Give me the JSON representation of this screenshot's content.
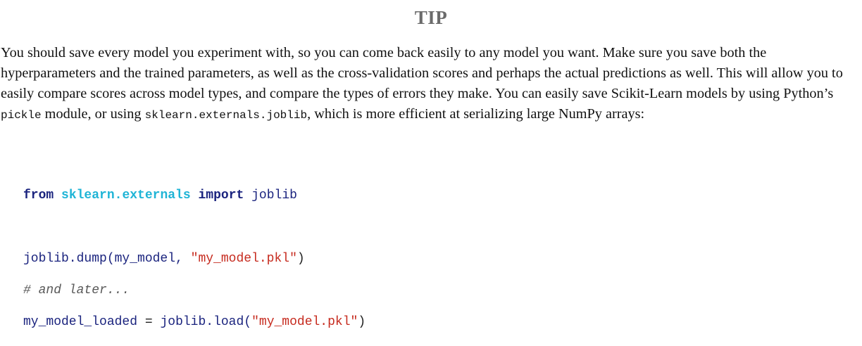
{
  "title": "TIP",
  "paragraph": {
    "text_1": "You should save every model you experiment with, so you can come back easily to any model you want. Make sure you save both the hyperparameters and the trained parameters, as well as the cross-validation scores and perhaps the actual predictions as well. This will allow you to easily compare scores across model types, and compare the types of errors they make. You can easily save Scikit-Learn models by using Python’s ",
    "code_1": "pickle",
    "text_2": " module, or using ",
    "code_2": "sklearn.externals.joblib",
    "text_3": ", which is more efficient at serializing large NumPy arrays:"
  },
  "code": {
    "line1": {
      "kw_from": "from",
      "module": "sklearn.externals",
      "kw_import": "import",
      "name": "joblib"
    },
    "line2": {
      "call": "joblib.dump(my_model,",
      "arg": "\"my_model.pkl\"",
      "close": ")"
    },
    "line3": {
      "comment": "# and later..."
    },
    "line4": {
      "var": "my_model_loaded",
      "op": "=",
      "call": "joblib.load(",
      "arg": "\"my_model.pkl\"",
      "close": ")"
    }
  }
}
